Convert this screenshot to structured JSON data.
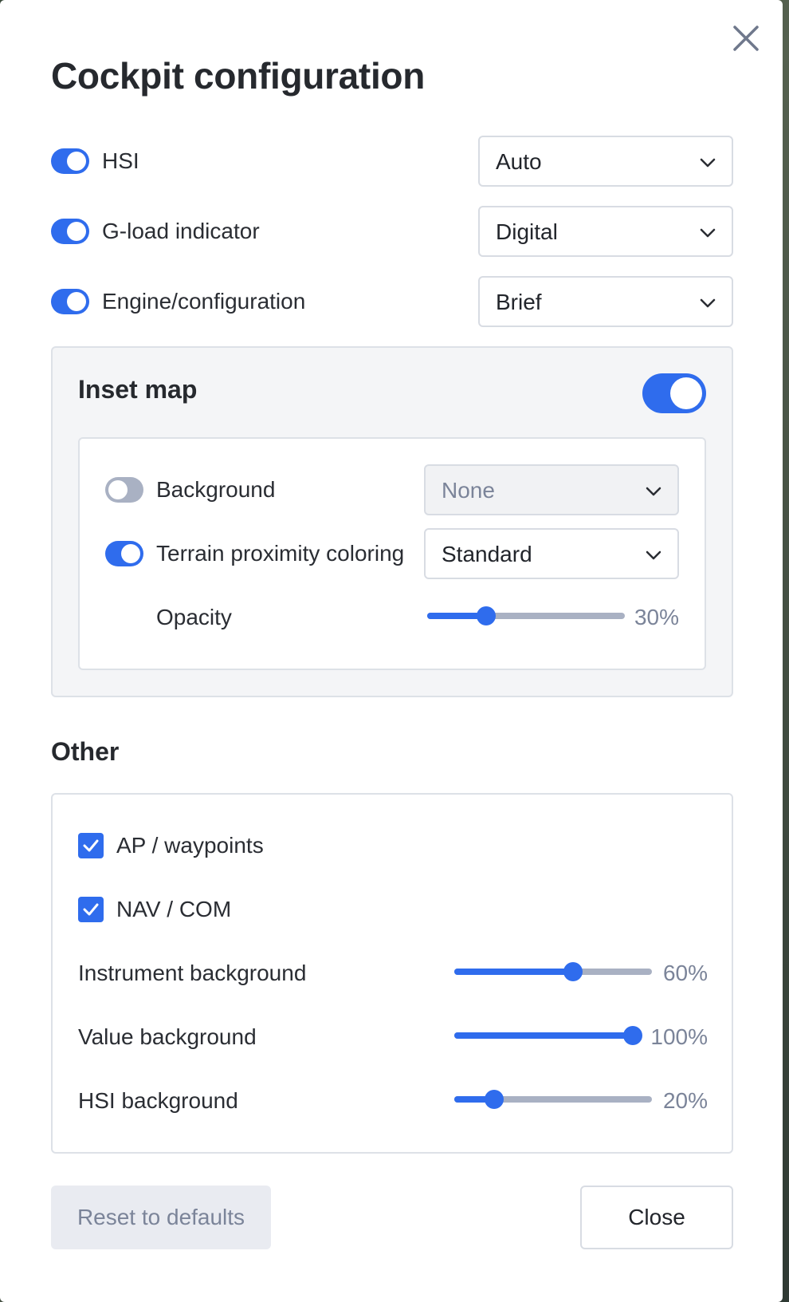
{
  "dialog": {
    "title": "Cockpit configuration"
  },
  "top_rows": [
    {
      "label": "HSI",
      "enabled": true,
      "select_value": "Auto"
    },
    {
      "label": "G-load indicator",
      "enabled": true,
      "select_value": "Digital"
    },
    {
      "label": "Engine/configuration",
      "enabled": true,
      "select_value": "Brief"
    }
  ],
  "inset_map": {
    "title": "Inset map",
    "enabled": true,
    "background": {
      "label": "Background",
      "enabled": false,
      "select_value": "None"
    },
    "terrain": {
      "label": "Terrain proximity coloring",
      "enabled": true,
      "select_value": "Standard"
    },
    "opacity": {
      "label": "Opacity",
      "value": 30,
      "value_text": "30%"
    }
  },
  "other": {
    "title": "Other",
    "ap_waypoints": {
      "label": "AP / waypoints",
      "checked": true
    },
    "nav_com": {
      "label": "NAV / COM",
      "checked": true
    },
    "instrument_background": {
      "label": "Instrument background",
      "value": 60,
      "value_text": "60%"
    },
    "value_background": {
      "label": "Value background",
      "value": 100,
      "value_text": "100%"
    },
    "hsi_background": {
      "label": "HSI background",
      "value": 20,
      "value_text": "20%"
    }
  },
  "footer": {
    "reset_label": "Reset to defaults",
    "close_label": "Close"
  },
  "colors": {
    "accent": "#2f6ced",
    "toggle_off": "#a9b1c3",
    "muted_text": "#7b8499",
    "border": "#d8dce3"
  },
  "icons": {
    "close": "close-icon",
    "chevron": "chevron-down-icon",
    "check": "check-icon"
  }
}
